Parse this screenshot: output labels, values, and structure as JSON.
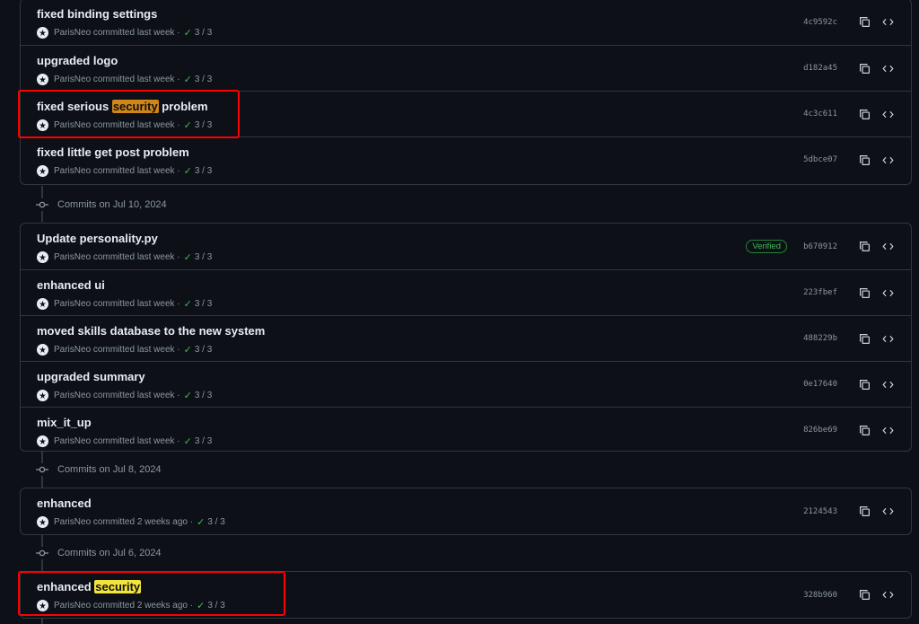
{
  "groups": [
    {
      "commits": [
        {
          "title": "fixed binding settings",
          "author": "ParisNeo",
          "time": "committed last week",
          "checks": "3 / 3",
          "sha": "4c9592c"
        },
        {
          "title": "upgraded logo",
          "author": "ParisNeo",
          "time": "committed last week",
          "checks": "3 / 3",
          "sha": "d182a45"
        },
        {
          "title_pre": "fixed serious ",
          "title_hl": "security",
          "title_post": " problem",
          "author": "ParisNeo",
          "time": "committed last week",
          "checks": "3 / 3",
          "sha": "4c3c611"
        },
        {
          "title": "fixed little get post problem",
          "author": "ParisNeo",
          "time": "committed last week",
          "checks": "3 / 3",
          "sha": "5dbce07"
        }
      ]
    },
    {
      "date": "Commits on Jul 10, 2024",
      "commits": [
        {
          "title": "Update personality.py",
          "author": "ParisNeo",
          "time": "committed last week",
          "checks": "3 / 3",
          "sha": "b670912",
          "badge": "Verified"
        },
        {
          "title": "enhanced ui",
          "author": "ParisNeo",
          "time": "committed last week",
          "checks": "3 / 3",
          "sha": "223fbef"
        },
        {
          "title": "moved skills database to the new system",
          "author": "ParisNeo",
          "time": "committed last week",
          "checks": "3 / 3",
          "sha": "488229b"
        },
        {
          "title": "upgraded summary",
          "author": "ParisNeo",
          "time": "committed last week",
          "checks": "3 / 3",
          "sha": "0e17640"
        },
        {
          "title": "mix_it_up",
          "author": "ParisNeo",
          "time": "committed last week",
          "checks": "3 / 3",
          "sha": "826be69"
        }
      ]
    },
    {
      "date": "Commits on Jul 8, 2024",
      "commits": [
        {
          "title": "enhanced",
          "author": "ParisNeo",
          "time": "committed 2 weeks ago",
          "checks": "3 / 3",
          "sha": "2124543"
        }
      ]
    },
    {
      "date": "Commits on Jul 6, 2024",
      "commits": [
        {
          "title_pre": "enhanced ",
          "title_hl": "security",
          "title_post": "",
          "author": "ParisNeo",
          "time": "committed 2 weeks ago",
          "checks": "3 / 3",
          "sha": "328b960"
        }
      ]
    }
  ],
  "icons": {
    "copy": "copy-icon",
    "browse": "code-brackets-icon",
    "commit_node": "git-commit-icon",
    "avatar": "avatar-logo-icon",
    "check": "check-icon"
  },
  "colors": {
    "bg": "#0d1117",
    "border": "#30363d",
    "highlight_orange": "#d18616",
    "highlight_yellow": "#f2e43a",
    "annotation": "#ff0000",
    "success": "#3fb950"
  }
}
